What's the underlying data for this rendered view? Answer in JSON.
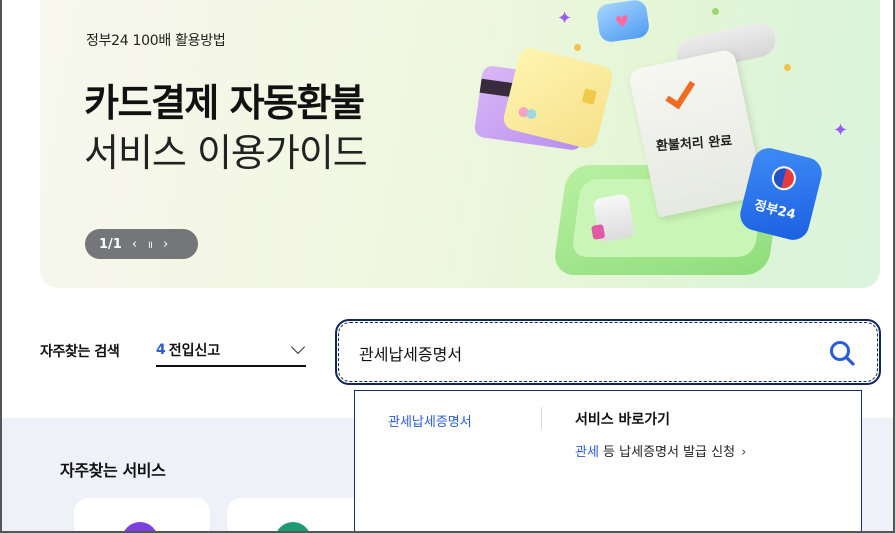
{
  "banner": {
    "eyebrow": "정부24 100배 활용방법",
    "title_strong": "카드결제 자동환불",
    "title_light": "서비스 이용가이드",
    "illustration_receipt_text": "환불처리 완료",
    "illustration_badge_text": "정부24",
    "pager": {
      "count": "1/1",
      "prev_icon": "‹",
      "pause_icon": "॥",
      "next_icon": "›"
    }
  },
  "search": {
    "frequent_label": "자주찾는 검색",
    "frequent_rank": "4",
    "frequent_term": "전입신고",
    "query": "관세납세증명서",
    "accent_color": "#13265c"
  },
  "autocomplete": {
    "suggestion": "관세납세증명서",
    "shortcut_heading": "서비스 바로가기",
    "shortcut_highlight": "관세",
    "shortcut_rest": " 등 납세증명서 발급 신청",
    "shortcut_arrow": "›"
  },
  "services": {
    "title": "자주찾는 서비스"
  },
  "icons": [
    "search-icon",
    "chevron-down-icon",
    "prev-icon",
    "pause-icon",
    "next-icon"
  ]
}
